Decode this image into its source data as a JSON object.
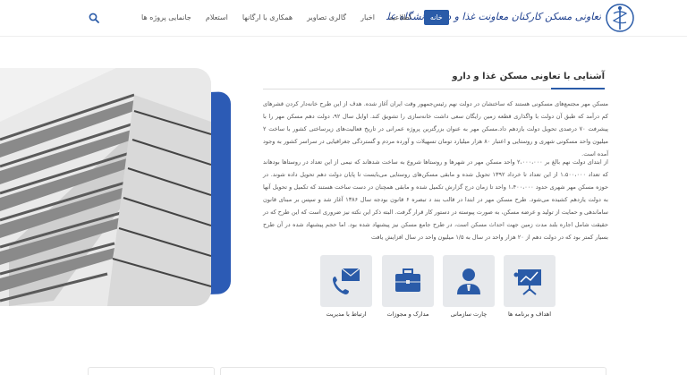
{
  "header": {
    "logo_text": "تعاونی مسکن کارکنان معاونت غذا و دارو دانشگاه علوم پزشکی تهران",
    "nav": [
      {
        "label": "خانه",
        "active": true
      },
      {
        "label": "اطلاعیه",
        "active": false
      },
      {
        "label": "اخبار",
        "active": false
      },
      {
        "label": "گالری تصاویر",
        "active": false
      },
      {
        "label": "همکاری با ارگانها",
        "active": false
      },
      {
        "label": "استعلام",
        "active": false
      },
      {
        "label": "جانمایی پروژه ها",
        "active": false
      }
    ],
    "search_icon": "search-icon",
    "accent": "#2a5ba8"
  },
  "main": {
    "title": "آشنایی با تعاونی مسکن غذا و دارو",
    "paragraph1": "مسکن مهر مجتمع‌های مسکونی هستند که ساختشان در دولت نهم رئیس‌جمهور وقت ایران آغاز شده. هدف از این طرح خانه‌دار کردن قشرهای کم درآمد که طبق آن دولت با واگذاری قطعه زمین رایگان سعی داشت خانه‌سازی را تشویق کند. اوایل سال ۹۲، دولت دهم مسکن مهر را با پیشرفت ۷۰ درصدی تحویل دولت یازدهم داد.مسکن مهر به عنوان بزرگترین پروژه عمرانی در تاریخ فعالیت‌های زیرساختی کشور با ساخت ۲ میلیون واحد مسکونی شهری و روستایی و اعتبار ۸۰ هزار میلیارد تومان تسهیلات و آورده مردم و گستردگی جغرافیایی در سراسر کشور به وجود آمده است.",
    "paragraph2": "از ابتدای دولت نهم بالغ بر ۲،۰۰۰،۰۰۰ واحد مسکن مهر در شهرها و روستاها شروع به ساخت شدهاند که نیمی از این تعداد در روستاها بودهاند که تعداد ۱،۵۰۰،۰۰۰ از این تعداد تا خرداد ۱۳۹۲ تحویل شده و مابقی مسکن‌های روستایی می‌بایست تا پایان دولت دهم تحویل داده شوند. در حوزه مسکن مهر شهری حدود ۱،۴۰۰،۰۰۰ واحد تا زمان درج گزارش تکمیل شده و مابقی همچنان در دست ساخت هستند که تکمیل و تحویل آنها به دولت یازدهم کشیده می‌شود. طرح مسکن مهر در ابتدا در قالب بند د تبصره ۶ قانون بودجه سال ۱۳۸۶ آغاز شد و سپس بر مبنای قانون ساماندهی و حمایت از تولید و عرضه مسکن، به صورت پیوسته در دستور کار قرار گرفت. البته ذکر این نکته نیز ضروری است که این طرح که در حقیقت شامل اجاره بلند مدت زمین جهت احداث مسکن است، در طرح جامع مسکن نیز پیشنهاد شده بود. اما حجم پیشنهاد شده در آن طرح بسیار کمتر بود که در دولت دهم از ۲۰ هزار واحد در سال به ۱/۵ میلیون واحد در سال افزایش یافت"
  },
  "features": [
    {
      "label": "اهداف و برنامه ها",
      "icon": "presentation-board-icon"
    },
    {
      "label": "چارت سازمانی",
      "icon": "user-profile-icon"
    },
    {
      "label": "مدارک و مجوزات",
      "icon": "briefcase-icon"
    },
    {
      "label": "ارتباط با مدیریت",
      "icon": "mail-phone-icon"
    }
  ]
}
